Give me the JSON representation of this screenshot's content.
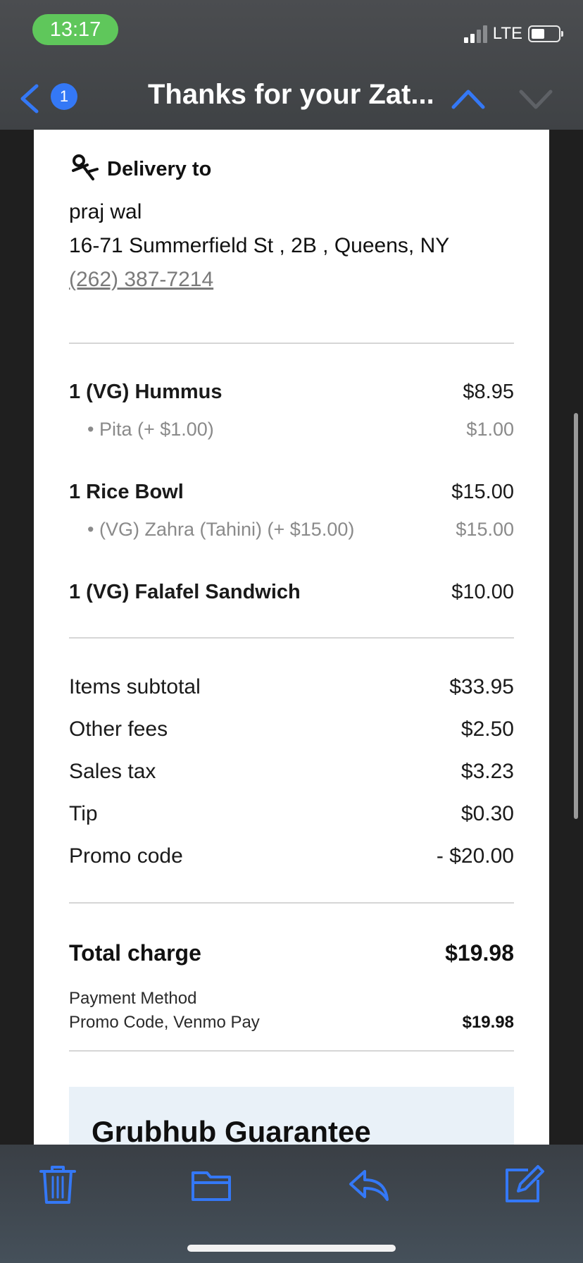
{
  "status": {
    "time": "13:17",
    "network": "LTE"
  },
  "nav": {
    "title": "Thanks for your Zat...",
    "unread_count": "1"
  },
  "delivery": {
    "heading": "Delivery to",
    "name": "praj wal",
    "address": "16-71 Summerfield St , 2B , Queens, NY",
    "phone": "(262) 387-7214"
  },
  "items": [
    {
      "name": "1 (VG) Hummus",
      "price": "$8.95",
      "modifier": "• Pita (+ $1.00)",
      "modifier_price": "$1.00"
    },
    {
      "name": "1 Rice Bowl",
      "price": "$15.00",
      "modifier": "• (VG) Zahra (Tahini) (+ $15.00)",
      "modifier_price": "$15.00"
    },
    {
      "name": "1 (VG) Falafel Sandwich",
      "price": "$10.00"
    }
  ],
  "fees": [
    {
      "label": "Items subtotal",
      "value": "$33.95"
    },
    {
      "label": "Other fees",
      "value": "$2.50"
    },
    {
      "label": "Sales tax",
      "value": "$3.23"
    },
    {
      "label": "Tip",
      "value": "$0.30"
    },
    {
      "label": "Promo code",
      "value": "- $20.00"
    }
  ],
  "total": {
    "label": "Total charge",
    "value": "$19.98"
  },
  "payment": {
    "label": "Payment Method",
    "methods": "Promo Code, Venmo Pay",
    "amount": "$19.98"
  },
  "guarantee": {
    "title": "Grubhub Guarantee"
  },
  "colors": {
    "accent": "#3478f6",
    "time_pill": "#5fc75b"
  }
}
